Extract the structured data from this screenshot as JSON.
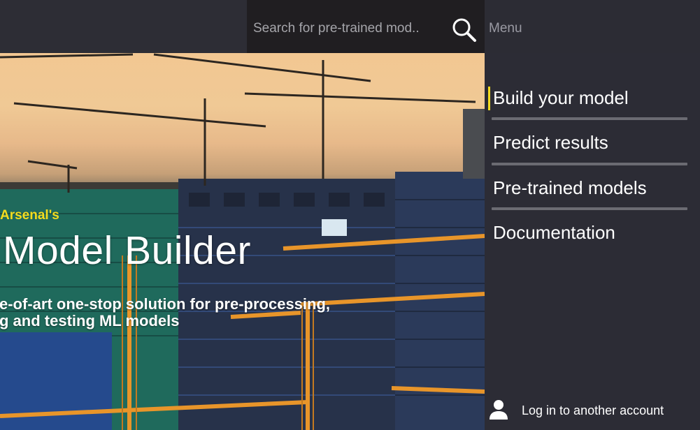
{
  "search": {
    "placeholder": "Search for pre-trained mod..",
    "button_icon": "search-icon"
  },
  "menu": {
    "label": "Menu",
    "items": [
      {
        "label": "Build your model",
        "active": true
      },
      {
        "label": "Predict results",
        "active": false
      },
      {
        "label": "Pre-trained models",
        "active": false
      },
      {
        "label": "Documentation",
        "active": false
      }
    ],
    "account": {
      "icon": "user-icon",
      "label": "Log in to another account"
    }
  },
  "hero": {
    "kicker": "Arsenal's",
    "title": "Model Builder",
    "subtitle_line1": "e-of-art one-stop solution for pre-processing,",
    "subtitle_line2": "g and testing ML models",
    "image": "construction-site-with-cranes"
  },
  "colors": {
    "accent": "#f4dc1e",
    "panel": "#2c2c35",
    "search_bg": "#201e21",
    "divider": "#6b6b72"
  }
}
